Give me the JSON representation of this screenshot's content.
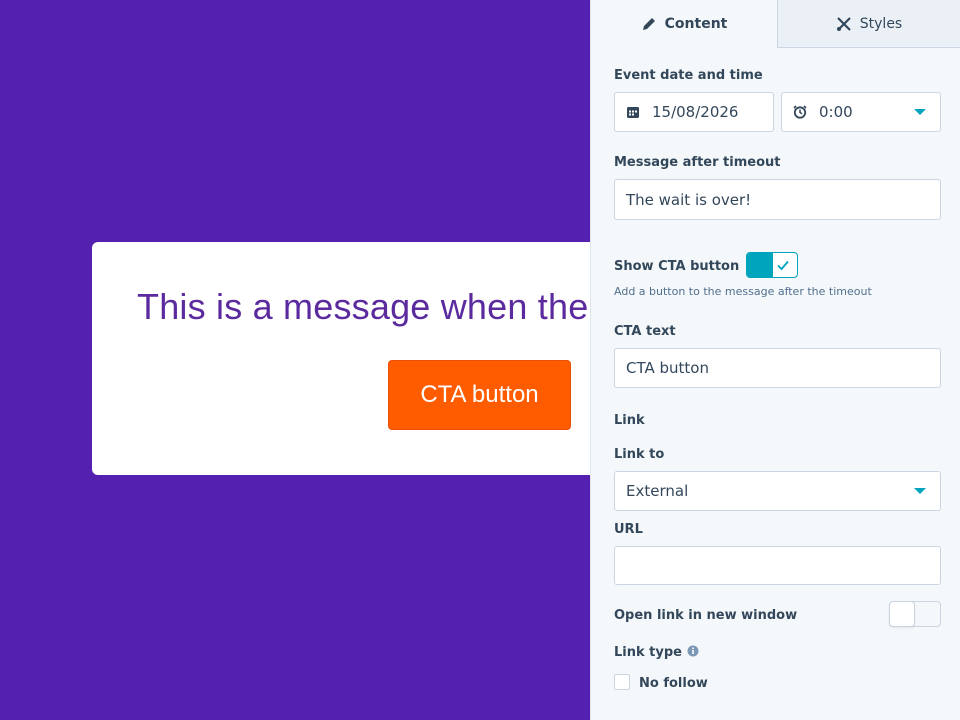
{
  "preview": {
    "message": "This is a message when the timer runs out",
    "cta_label": "CTA button"
  },
  "tabs": [
    {
      "label": "Content",
      "icon": "pencil-icon",
      "active": true
    },
    {
      "label": "Styles",
      "icon": "brush-icon",
      "active": false
    }
  ],
  "form": {
    "event_date_label": "Event date and time",
    "date_value": "15/08/2026",
    "time_value": "0:00",
    "timeout_message_label": "Message after timeout",
    "timeout_message_value": "The wait is over!",
    "show_cta_label": "Show CTA button",
    "show_cta_enabled": true,
    "show_cta_help": "Add a button to the message after the timeout",
    "cta_text_label": "CTA text",
    "cta_text_value": "CTA button",
    "link_section_label": "Link",
    "link_to_label": "Link to",
    "link_to_value": "External",
    "url_label": "URL",
    "url_value": "",
    "new_window_label": "Open link in new window",
    "new_window_enabled": false,
    "link_type_label": "Link type",
    "no_follow_label": "No follow",
    "no_follow_checked": false
  },
  "colors": {
    "canvas_bg": "#5420b0",
    "message_text": "#5b2a9e",
    "cta_bg": "#ff5c00",
    "accent": "#00a4bd",
    "panel_bg": "#f5f8fa"
  }
}
